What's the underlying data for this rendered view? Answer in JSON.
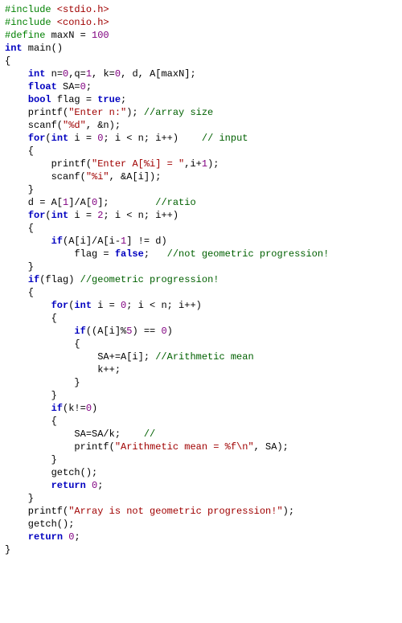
{
  "code": {
    "l1a": "#include",
    "l1b": " <stdio.h>",
    "l2a": "#include",
    "l2b": " <conio.h>",
    "l3a": "#define",
    "l3b": " maxN = ",
    "l3c": "100",
    "l4a": "int",
    "l4b": " main()",
    "l5": "{",
    "l6a": "    ",
    "l6b": "int",
    "l6c": " n=",
    "l6d": "0",
    "l6e": ",q=",
    "l6f": "1",
    "l6g": ", k=",
    "l6h": "0",
    "l6i": ", d, A[maxN];",
    "l7a": "    ",
    "l7b": "float",
    "l7c": " SA=",
    "l7d": "0",
    "l7e": ";",
    "l8a": "    ",
    "l8b": "bool",
    "l8c": " flag = ",
    "l8d": "true",
    "l8e": ";",
    "l9a": "    printf(",
    "l9b": "\"Enter n:\"",
    "l9c": "); ",
    "l9d": "//array size",
    "l10a": "    scanf(",
    "l10b": "\"%d\"",
    "l10c": ", &n);",
    "l11a": "    ",
    "l11b": "for",
    "l11c": "(",
    "l11d": "int",
    "l11e": " i = ",
    "l11f": "0",
    "l11g": "; i < n; i++)    ",
    "l11h": "// input",
    "l12": "    {",
    "l13a": "        printf(",
    "l13b": "\"Enter A[%i] = \"",
    "l13c": ",i+",
    "l13d": "1",
    "l13e": ");",
    "l14a": "        scanf(",
    "l14b": "\"%i\"",
    "l14c": ", &A[i]);",
    "l15": "    }",
    "l16a": "    d = A[",
    "l16b": "1",
    "l16c": "]/A[",
    "l16d": "0",
    "l16e": "];        ",
    "l16f": "//ratio",
    "l17a": "    ",
    "l17b": "for",
    "l17c": "(",
    "l17d": "int",
    "l17e": " i = ",
    "l17f": "2",
    "l17g": "; i < n; i++)",
    "l18": "    {",
    "l19a": "        ",
    "l19b": "if",
    "l19c": "(A[i]/A[i-",
    "l19d": "1",
    "l19e": "] != d)",
    "l20a": "            flag = ",
    "l20b": "false",
    "l20c": ";   ",
    "l20d": "//not geometric progression!",
    "l21": "    }",
    "l22a": "    ",
    "l22b": "if",
    "l22c": "(flag) ",
    "l22d": "//geometric progression!",
    "l23": "    {",
    "l24a": "        ",
    "l24b": "for",
    "l24c": "(",
    "l24d": "int",
    "l24e": " i = ",
    "l24f": "0",
    "l24g": "; i < n; i++)",
    "l25": "        {",
    "l26a": "            ",
    "l26b": "if",
    "l26c": "((A[i]%",
    "l26d": "5",
    "l26e": ") == ",
    "l26f": "0",
    "l26g": ")",
    "l27": "            {",
    "l28a": "                SA+=A[i]; ",
    "l28b": "//Arithmetic mean",
    "l29": "                k++;",
    "l30": "            }",
    "l31": "        }",
    "l32a": "        ",
    "l32b": "if",
    "l32c": "(k!=",
    "l32d": "0",
    "l32e": ")",
    "l33": "        {",
    "l34a": "            SA=SA/k;    ",
    "l34b": "//",
    "l35a": "            printf(",
    "l35b": "\"Arithmetic mean = %f\\n\"",
    "l35c": ", SA);",
    "l36": "        }",
    "l37": "        getch();",
    "l38a": "        ",
    "l38b": "return",
    "l38c": " ",
    "l38d": "0",
    "l38e": ";",
    "l39": "    }",
    "l40a": "    printf(",
    "l40b": "\"Array is not geometric progression!\"",
    "l40c": ");",
    "l41": "    getch();",
    "l42a": "    ",
    "l42b": "return",
    "l42c": " ",
    "l42d": "0",
    "l42e": ";",
    "l43": "}"
  }
}
